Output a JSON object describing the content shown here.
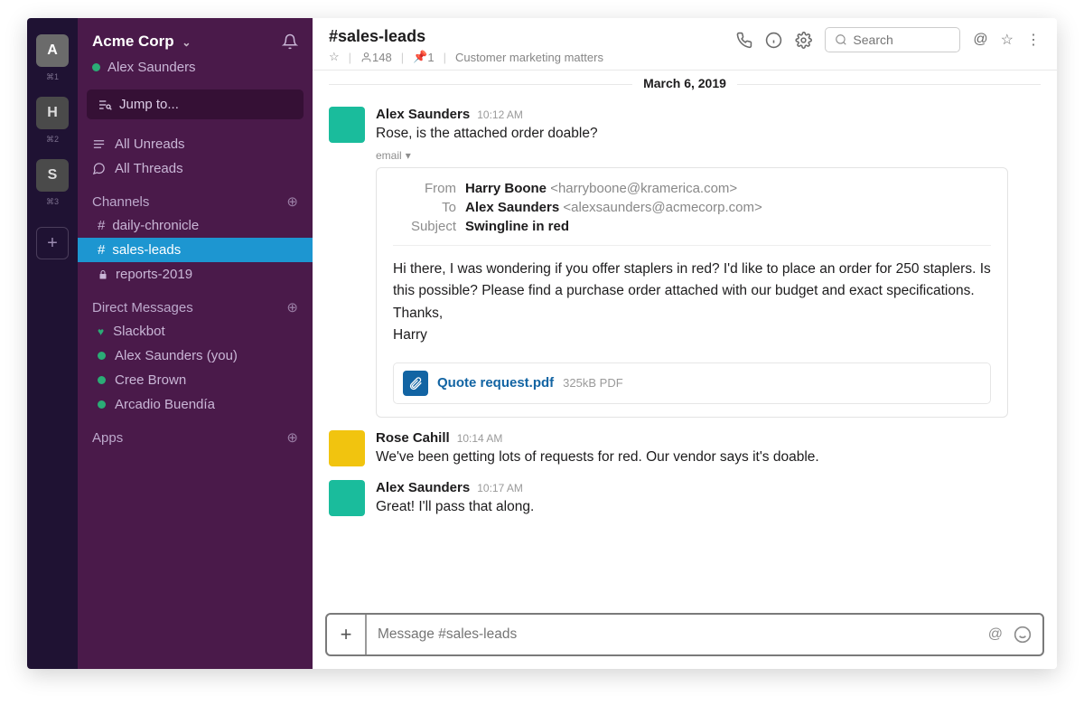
{
  "workspaces": [
    {
      "letter": "A",
      "shortcut": "⌘1",
      "active": true
    },
    {
      "letter": "H",
      "shortcut": "⌘2",
      "active": false
    },
    {
      "letter": "S",
      "shortcut": "⌘3",
      "active": false
    }
  ],
  "sidebar": {
    "workspace_name": "Acme Corp",
    "current_user": "Alex Saunders",
    "jump_label": "Jump to...",
    "all_unreads": "All Unreads",
    "all_threads": "All Threads",
    "channels_header": "Channels",
    "channels": [
      {
        "prefix": "#",
        "name": "daily-chronicle",
        "active": false,
        "locked": false
      },
      {
        "prefix": "#",
        "name": "sales-leads",
        "active": true,
        "locked": false
      },
      {
        "prefix": "🔒",
        "name": "reports-2019",
        "active": false,
        "locked": true
      }
    ],
    "dm_header": "Direct Messages",
    "dms": [
      {
        "name": "Slackbot",
        "heart": true
      },
      {
        "name": "Alex Saunders (you)",
        "heart": false
      },
      {
        "name": "Cree Brown",
        "heart": false
      },
      {
        "name": "Arcadio Buendía",
        "heart": false
      }
    ],
    "apps_header": "Apps"
  },
  "header": {
    "channel_name": "#sales-leads",
    "members": "148",
    "pins": "1",
    "topic": "Customer marketing matters",
    "search_placeholder": "Search"
  },
  "divider_date": "March 6, 2019",
  "messages": [
    {
      "author": "Alex Saunders",
      "time": "10:12 AM",
      "avatar": "av1",
      "body": "Rose, is the attached order doable?",
      "email": {
        "tag": "email",
        "from_name": "Harry Boone",
        "from_email": "<harryboone@kramerica.com>",
        "to_name": "Alex Saunders",
        "to_email": "<alexsaunders@acmecorp.com>",
        "subject": "Swingline in red",
        "labels": {
          "from": "From",
          "to": "To",
          "subject": "Subject"
        },
        "body_lines": [
          "Hi there, I was wondering if you offer staplers in red? I'd like to place an order for 250 staplers. Is this possible? Please find a purchase order attached with our budget and exact specifications.",
          "Thanks,",
          "Harry"
        ],
        "attachment": {
          "name": "Quote request.pdf",
          "meta": "325kB PDF"
        }
      }
    },
    {
      "author": "Rose Cahill",
      "time": "10:14 AM",
      "avatar": "av2",
      "body": "We've been getting lots of requests for red. Our vendor says it's doable."
    },
    {
      "author": "Alex Saunders",
      "time": "10:17 AM",
      "avatar": "av1",
      "body": "Great! I'll pass that along."
    }
  ],
  "composer": {
    "placeholder": "Message #sales-leads"
  }
}
